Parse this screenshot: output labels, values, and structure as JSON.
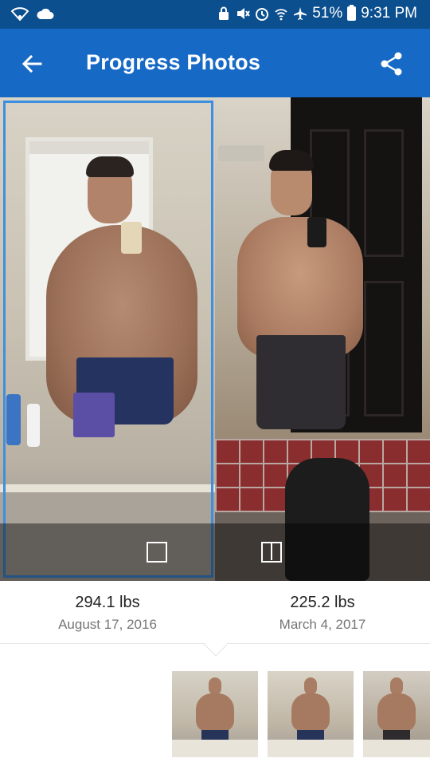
{
  "status_bar": {
    "battery": "51%",
    "time": "9:31 PM",
    "icons": [
      "wifi-icon",
      "cloud-icon",
      "lock-icon",
      "mute-icon",
      "alarm-icon",
      "wifi-calling-icon",
      "airplane-icon",
      "battery-icon"
    ]
  },
  "app_bar": {
    "title": "Progress Photos",
    "back_icon": "arrow-back-icon",
    "share_icon": "share-icon"
  },
  "compare": {
    "left_photo": {
      "weight": "294.1 lbs",
      "date": "August 17, 2016",
      "selected": true
    },
    "right_photo": {
      "weight": "225.2 lbs",
      "date": "March 4, 2017",
      "selected": false
    },
    "modes": [
      "single-view-icon",
      "split-view-icon"
    ]
  },
  "thumbnails": {
    "count": 3
  },
  "colors": {
    "status_bar": "#0b4f8f",
    "app_bar": "#1669c4",
    "selection": "#3d8fe0",
    "weight_text": "#222222",
    "date_text": "#757575"
  }
}
